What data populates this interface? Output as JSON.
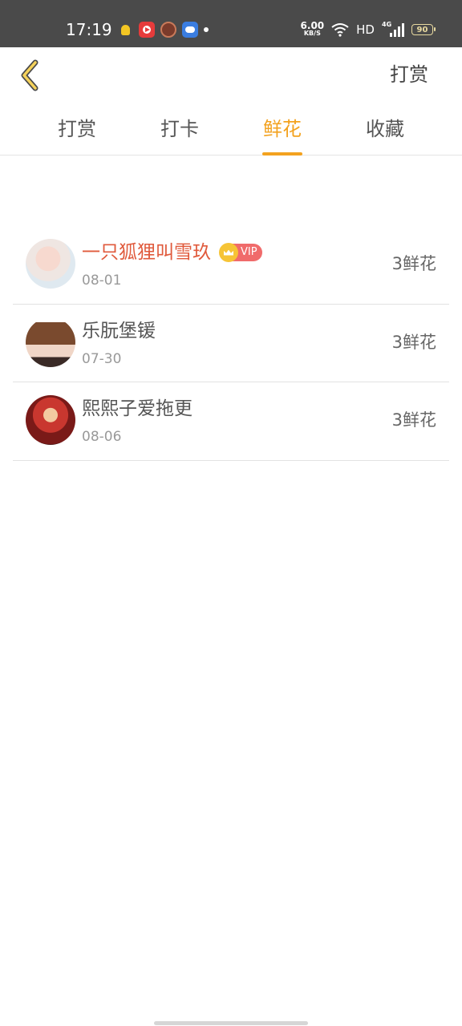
{
  "status_bar": {
    "time": "17:19",
    "net_speed_value": "6.00",
    "net_speed_unit": "KB/S",
    "hd_label": "HD",
    "network_type": "4G",
    "battery_level": "90",
    "app_icons": [
      "bulb-icon",
      "video-app-icon",
      "avatar-app-icon",
      "cloud-app-icon"
    ]
  },
  "header": {
    "back_icon": "chevron-left-icon",
    "action_label": "打赏"
  },
  "tabs": [
    {
      "label": "打赏",
      "active": false
    },
    {
      "label": "打卡",
      "active": false
    },
    {
      "label": "鲜花",
      "active": true
    },
    {
      "label": "收藏",
      "active": false
    }
  ],
  "list": [
    {
      "name": "一只狐狸叫雪玖",
      "vip": true,
      "vip_label": "VIP",
      "date": "08-01",
      "amount": "3鲜花"
    },
    {
      "name": "乐朊堡锾",
      "vip": false,
      "date": "07-30",
      "amount": "3鲜花"
    },
    {
      "name": "熙熙子爱拖更",
      "vip": false,
      "date": "08-06",
      "amount": "3鲜花"
    }
  ],
  "colors": {
    "accent": "#f3a21f",
    "vip_name": "#e05a3c",
    "vip_badge": "#f06b6b",
    "status_bar_bg": "#4a4a4a"
  }
}
